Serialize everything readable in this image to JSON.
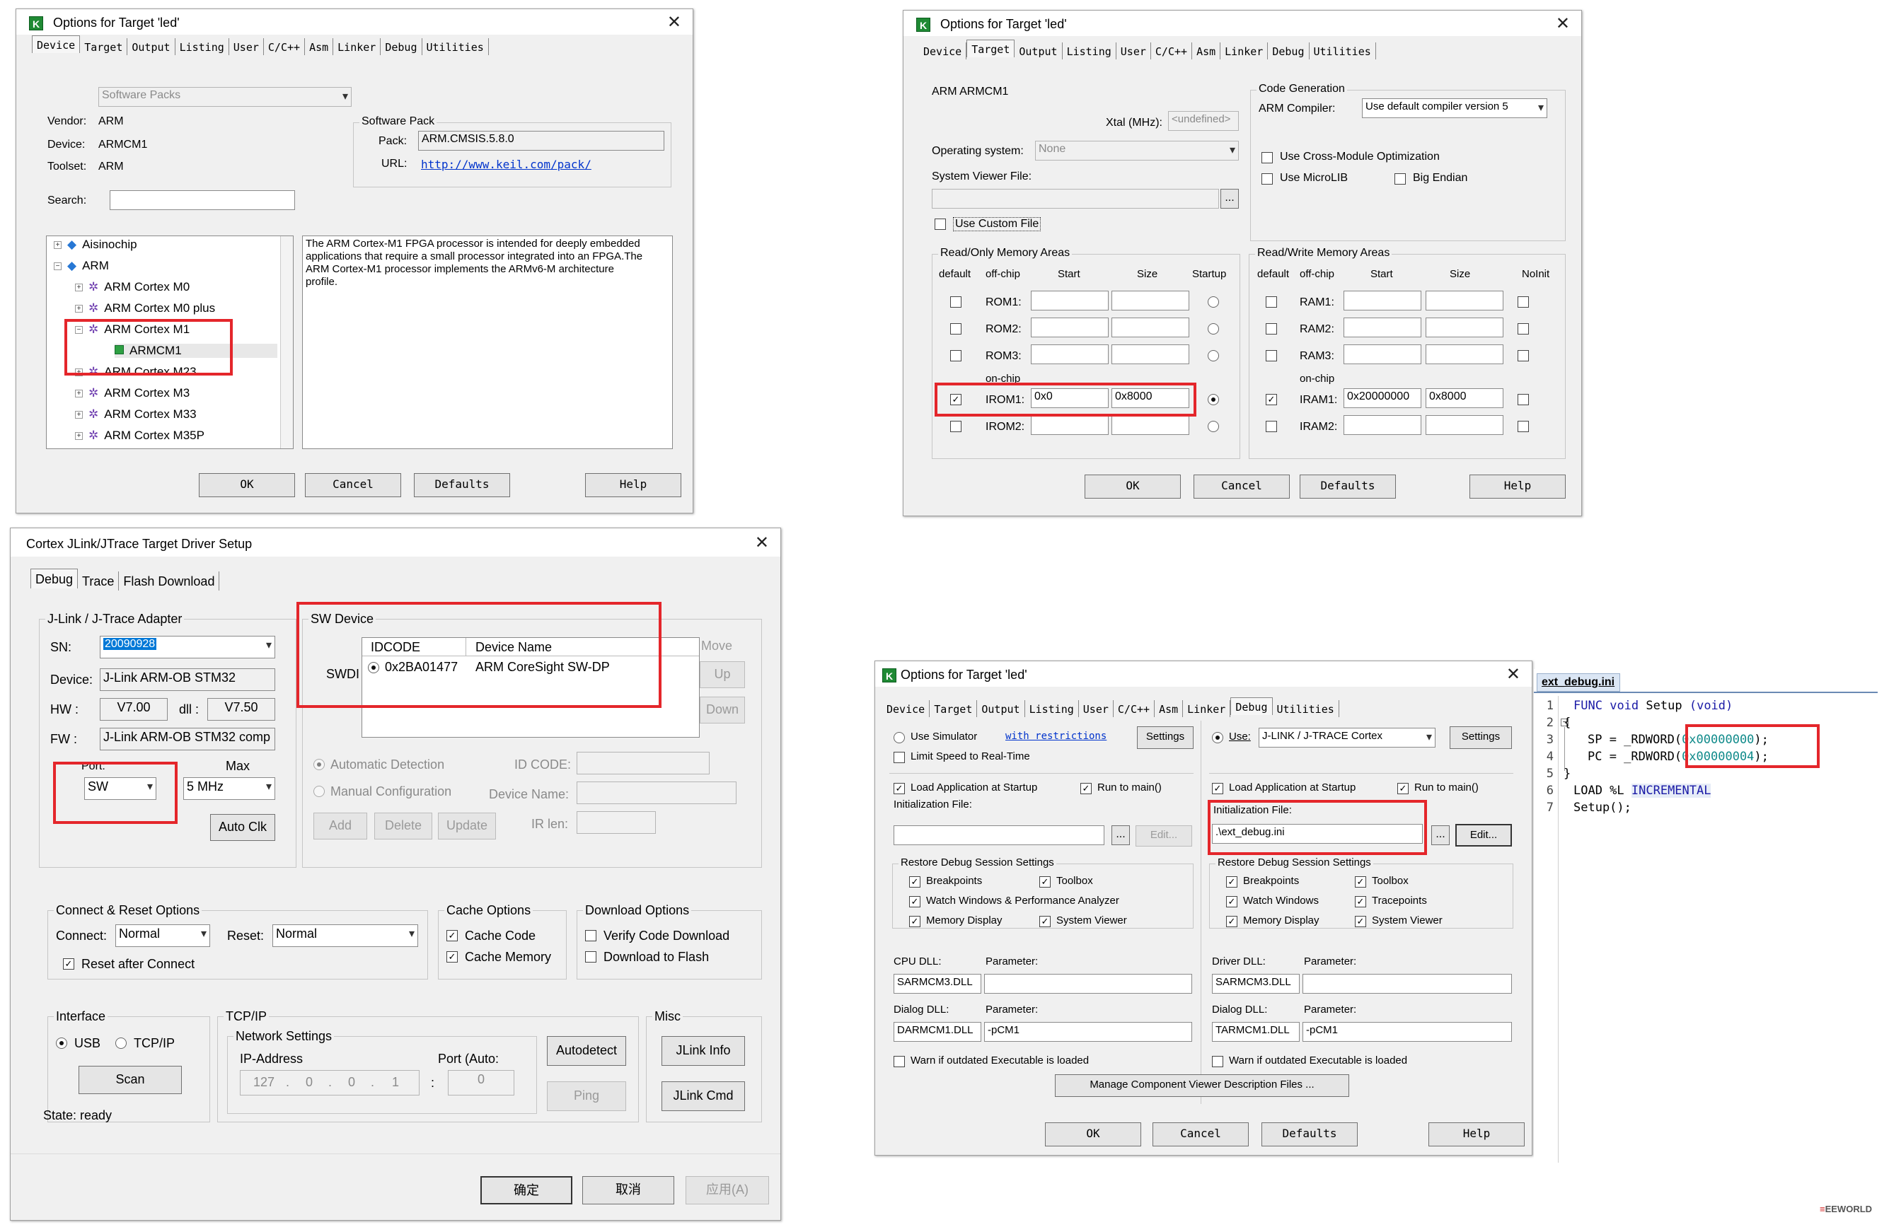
{
  "common": {
    "ok": "OK",
    "cancel": "Cancel",
    "defaults": "Defaults",
    "help": "Help"
  },
  "dlg1": {
    "title": "Options for Target 'led'",
    "tabs": [
      "Device",
      "Target",
      "Output",
      "Listing",
      "User",
      "C/C++",
      "Asm",
      "Linker",
      "Debug",
      "Utilities"
    ],
    "software_packs": "Software Packs",
    "vendor_label": "Vendor:",
    "vendor": "ARM",
    "device_label": "Device:",
    "device": "ARMCM1",
    "toolset_label": "Toolset:",
    "toolset": "ARM",
    "search_label": "Search:",
    "sp_group": "Software Pack",
    "pack_label": "Pack:",
    "pack": "ARM.CMSIS.5.8.0",
    "url_label": "URL:",
    "url": "http://www.keil.com/pack/",
    "tree": [
      "Aisinochip",
      "ARM",
      "ARM Cortex M0",
      "ARM Cortex M0 plus",
      "ARM Cortex M1",
      "ARMCM1",
      "ARM Cortex M23",
      "ARM Cortex M3",
      "ARM Cortex M33",
      "ARM Cortex M35P"
    ],
    "description": "The ARM Cortex-M1 FPGA processor is intended for deeply embedded applications that require a small processor integrated into an FPGA.The ARM Cortex-M1 processor implements the ARMv6-M architecture profile."
  },
  "dlg2": {
    "title": "Options for Target 'led'",
    "device": "ARM ARMCM1",
    "xtal_label": "Xtal (MHz):",
    "xtal": "<undefined>",
    "os_label": "Operating system:",
    "os": "None",
    "svf_label": "System Viewer File:",
    "use_custom": "Use Custom File",
    "codegen": "Code Generation",
    "compiler_label": "ARM Compiler:",
    "compiler": "Use default compiler version 5",
    "cross_module": "Use Cross-Module Optimization",
    "microlib": "Use MicroLIB",
    "big_endian": "Big Endian",
    "ro_title": "Read/Only Memory Areas",
    "rw_title": "Read/Write Memory Areas",
    "col_default": "default",
    "col_offchip": "off-chip",
    "col_start": "Start",
    "col_size": "Size",
    "col_startup": "Startup",
    "col_noinit": "NoInit",
    "on_chip": "on-chip",
    "rom": [
      "ROM1:",
      "ROM2:",
      "ROM3:",
      "IROM1:",
      "IROM2:"
    ],
    "ram": [
      "RAM1:",
      "RAM2:",
      "RAM3:",
      "IRAM1:",
      "IRAM2:"
    ],
    "irom1_start": "0x0",
    "irom1_size": "0x8000",
    "iram1_start": "0x20000000",
    "iram1_size": "0x8000"
  },
  "dlg3": {
    "title": "Cortex JLink/JTrace Target Driver Setup",
    "tabs": [
      "Debug",
      "Trace",
      "Flash Download"
    ],
    "adapter": "J-Link / J-Trace Adapter",
    "sn_label": "SN:",
    "sn": "20090928",
    "device_label": "Device:",
    "device": "J-Link ARM-OB STM32",
    "hw_label": "HW :",
    "hw": "V7.00",
    "dll_label": "dll :",
    "dll": "V7.50",
    "fw_label": "FW :",
    "fw": "J-Link ARM-OB STM32 comp",
    "port_label": "Port:",
    "port": "SW",
    "max_label": "Max",
    "max": "5 MHz",
    "auto_clk": "Auto Clk",
    "sw_device": "SW Device",
    "swdi": "SWDI",
    "col_idcode": "IDCODE",
    "col_name": "Device Name",
    "idcode": "0x2BA01477",
    "dev_name": "ARM CoreSight SW-DP",
    "move": "Move",
    "up": "Up",
    "down": "Down",
    "auto_det": "Automatic Detection",
    "manual_cfg": "Manual Configuration",
    "id_code": "ID CODE:",
    "dev_name_lbl": "Device Name:",
    "add": "Add",
    "delete": "Delete",
    "update": "Update",
    "ir_len": "IR len:",
    "conn_reset": "Connect & Reset Options",
    "connect_label": "Connect:",
    "connect": "Normal",
    "reset_label": "Reset:",
    "reset": "Normal",
    "reset_after": "Reset after Connect",
    "cache_opts": "Cache Options",
    "cache_code": "Cache Code",
    "cache_mem": "Cache Memory",
    "dl_opts": "Download Options",
    "verify": "Verify Code Download",
    "dl_flash": "Download to Flash",
    "interface": "Interface",
    "usb": "USB",
    "tcpip_opt": "TCP/IP",
    "tcpip": "TCP/IP",
    "net_settings": "Network Settings",
    "ip_label": "IP-Address",
    "port_auto": "Port (Auto:",
    "ip": [
      "127",
      "0",
      "0",
      "1"
    ],
    "port_val": "0",
    "autodetect": "Autodetect",
    "ping": "Ping",
    "misc": "Misc",
    "jlink_info": "JLink Info",
    "jlink_cmd": "JLink Cmd",
    "scan": "Scan",
    "state": "State: ready",
    "ok": "确定",
    "cancel": "取消",
    "apply": "应用(A)"
  },
  "dlg4": {
    "title": "Options for Target 'led'",
    "use_sim": "Use Simulator",
    "restrictions": "with restrictions",
    "settings": "Settings",
    "limit_speed": "Limit Speed to Real-Time",
    "use": "Use:",
    "debugger": "J-LINK / J-TRACE Cortex",
    "load_app": "Load Application at Startup",
    "run_main": "Run to main()",
    "init_file": "Initialization File:",
    "init_val": ".\\ext_debug.ini",
    "dots": "...",
    "edit": "Edit...",
    "restore": "Restore Debug Session Settings",
    "breakpoints": "Breakpoints",
    "toolbox": "Toolbox",
    "watch_perf": "Watch Windows & Performance Analyzer",
    "watch": "Watch Windows",
    "tracepoints": "Tracepoints",
    "memdisp": "Memory Display",
    "sysview": "System Viewer",
    "cpu_dll": "CPU DLL:",
    "driver_dll": "Driver DLL:",
    "parameter": "Parameter:",
    "cpu_dll_val": "SARMCM3.DLL",
    "driver_dll_val": "SARMCM3.DLL",
    "dialog_dll": "Dialog DLL:",
    "dialog_dll_val": "DARMCM1.DLL",
    "dialog_param": "-pCM1",
    "dialog_dll_val2": "TARMCM1.DLL",
    "dialog_param2": "-pCM1",
    "warn": "Warn if outdated Executable is loaded",
    "manage": "Manage Component Viewer Description Files ..."
  },
  "editor": {
    "tab": "ext_debug.ini",
    "lines": [
      "1",
      "2",
      "3",
      "4",
      "5",
      "6",
      "7"
    ],
    "code": {
      "l1_kw": "FUNC",
      "l1_type": "void",
      "l1_name": "Setup",
      "l1_paren": "(void)",
      "l2": "{",
      "l3_a": "SP = _RDWORD(",
      "l3_num": "0x00000000",
      "l3_b": ");",
      "l4_a": "PC = _RDWORD(",
      "l4_num": "0x00000004",
      "l4_b": ");",
      "l5": "}",
      "l6_a": "LOAD %L ",
      "l6_kw": "INCREMENTAL",
      "l7": "Setup();"
    }
  },
  "watermark": "EEWORLD",
  "colors": {
    "highlight": "#e4262b",
    "accent": "#0078d7"
  }
}
